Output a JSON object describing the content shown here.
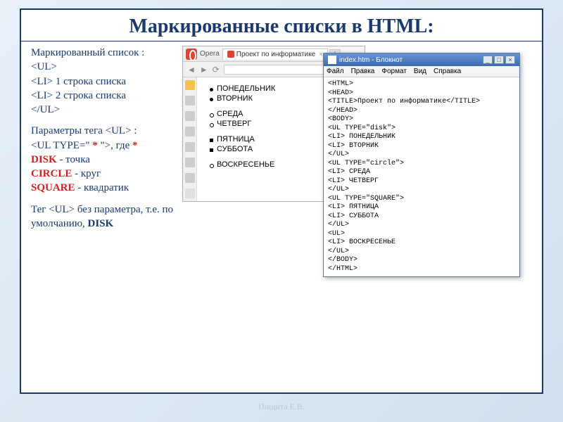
{
  "slide": {
    "title": "Маркированные списки в HTML:"
  },
  "left": {
    "heading": "Маркированный список :",
    "tag_ul_open": "<UL>",
    "tag_li1": "<LI> 1 строка списка",
    "tag_li2": "<LI> 2 строка списка",
    "tag_ul_close": "</UL>",
    "params_label_a": "Параметры тега ",
    "params_label_ul": "<UL>",
    "params_label_b": " :",
    "params_type_a": "<UL  TYPE=\" ",
    "params_type_star": "*",
    "params_type_b": " \">",
    "params_where": ", где ",
    "params_star2": "*",
    "disk_k": "DISK",
    "disk_v": "  - точка",
    "circle_k": "CIRCLE",
    "circle_v": "  - круг",
    "square_k": "SQUARE",
    "square_v": "  - квадратик",
    "note_a": "Тег ",
    "note_ul": "<UL>",
    "note_b": "  без параметра, т.е. по умолчанию, ",
    "note_disk": "DISK"
  },
  "opera": {
    "app_label": "Opera",
    "tab_title": "Проект по информатике",
    "list_disc": [
      "ПОНЕДЕЛЬНИК",
      "ВТОРНИК"
    ],
    "list_circle": [
      "СРЕДА",
      "ЧЕТВЕРГ"
    ],
    "list_square": [
      "ПЯТНИЦА",
      "СУББОТА"
    ],
    "list_default": [
      "ВОСКРЕСЕНЬЕ"
    ]
  },
  "notepad": {
    "title": "index.htm - Блокнот",
    "menu": [
      "Файл",
      "Правка",
      "Формат",
      "Вид",
      "Справка"
    ],
    "code": "<HTML>\n<HEAD>\n<TITLE>Проект по информатике</TITLE>\n</HEAD>\n<BODY>\n<UL TYPE=\"disk\">\n<LI> ПОНЕДЕЛЬНИК\n<LI> ВТОРНИК\n</UL>\n<UL TYPE=\"circle\">\n<LI> СРЕДА\n<LI> ЧЕТВЕРГ\n</UL>\n<UL TYPE=\"SQUARE\">\n<LI> ПЯТНИЦА\n<LI> СУББОТА\n</UL>\n<UL>\n<LI> ВОСКРЕСЕНЬЕ\n</UL>\n</BODY>\n</HTML>"
  },
  "footer": "Пищита Е.В."
}
